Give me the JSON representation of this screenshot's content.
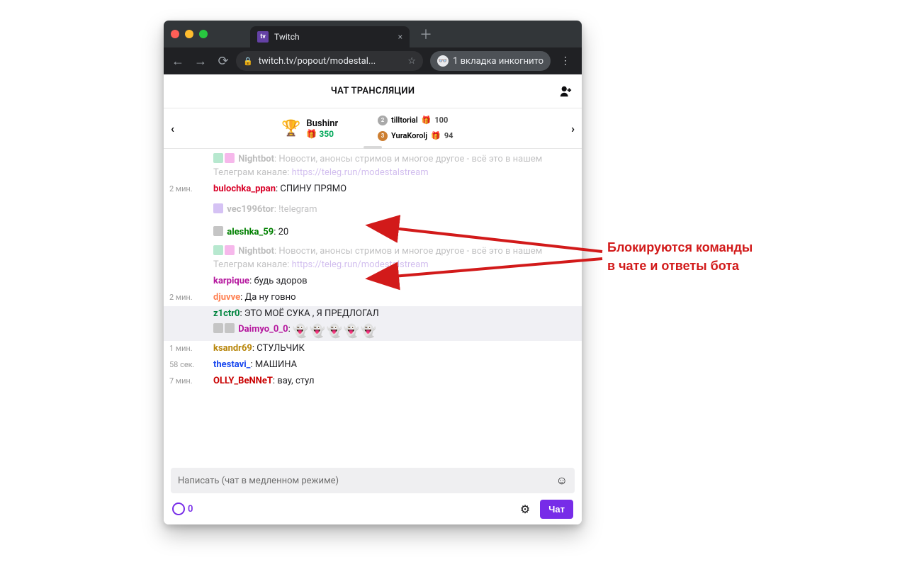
{
  "browser": {
    "tab_title": "Twitch",
    "url_display": "twitch.tv/popout/modestal...",
    "incognito_label": "1 вкладка инкогнито"
  },
  "header": {
    "title": "ЧАТ ТРАНСЛЯЦИИ"
  },
  "leaderboard": {
    "top": {
      "name": "Bushinr",
      "score": "350"
    },
    "second": {
      "name": "tilltorial",
      "score": "100"
    },
    "third": {
      "name": "YuraKorolj",
      "score": "94"
    }
  },
  "messages": [
    {
      "idx": 0,
      "ts": "",
      "user": "Nightbot",
      "sep": ": ",
      "text": "Новости, анонсы стримов и многое другое - всё это в нашем Телеграм канале: ",
      "link": "https://teleg.run/modestalstream"
    },
    {
      "idx": 1,
      "ts": "2 мин.",
      "user": "bulochka_ppan",
      "sep": ": ",
      "text": "СПИНУ ПРЯМО"
    },
    {
      "idx": 2,
      "ts": "",
      "user": "vec1996tor",
      "sep": ": ",
      "text": "!telegram"
    },
    {
      "idx": 3,
      "ts": "",
      "user": "aleshka_59",
      "sep": ": ",
      "text": "20"
    },
    {
      "idx": 4,
      "ts": "",
      "user": "Nightbot",
      "sep": ": ",
      "text": "Новости, анонсы стримов и многое другое - всё это в нашем Телеграм канале: ",
      "link": "https://teleg.run/modestalstream"
    },
    {
      "idx": 5,
      "ts": "",
      "user": "karpique",
      "sep": ": ",
      "text": "будь здоров"
    },
    {
      "idx": 6,
      "ts": "2 мин.",
      "user": "djuvve",
      "sep": ": ",
      "text": "Да ну говно"
    },
    {
      "idx": 7,
      "ts": "",
      "user": "z1ctr0",
      "sep": ": ",
      "text": "ЭТО МОЁ СУКА , Я ПРЕДЛОГАЛ"
    },
    {
      "idx": 8,
      "ts": "",
      "user": "Daimyo_0_0",
      "sep": ": ",
      "text": ""
    },
    {
      "idx": 9,
      "ts": "1 мин.",
      "user": "ksandr69",
      "sep": ": ",
      "text": "СТУЛЬЧИК"
    },
    {
      "idx": 10,
      "ts": "58 сек.",
      "user": "thestavi_",
      "sep": ": ",
      "text": "МАШИНА"
    },
    {
      "idx": 11,
      "ts": "7 мин.",
      "user": "OLLY_BeNNeT",
      "sep": ": ",
      "text": "вау, стул"
    }
  ],
  "composer": {
    "placeholder": "Написать (чат в медленном режиме)"
  },
  "points": {
    "value": "0"
  },
  "chat_button": "Чат",
  "annotation": {
    "line1": "Блокируются команды",
    "line2": "в чате и ответы бота"
  }
}
